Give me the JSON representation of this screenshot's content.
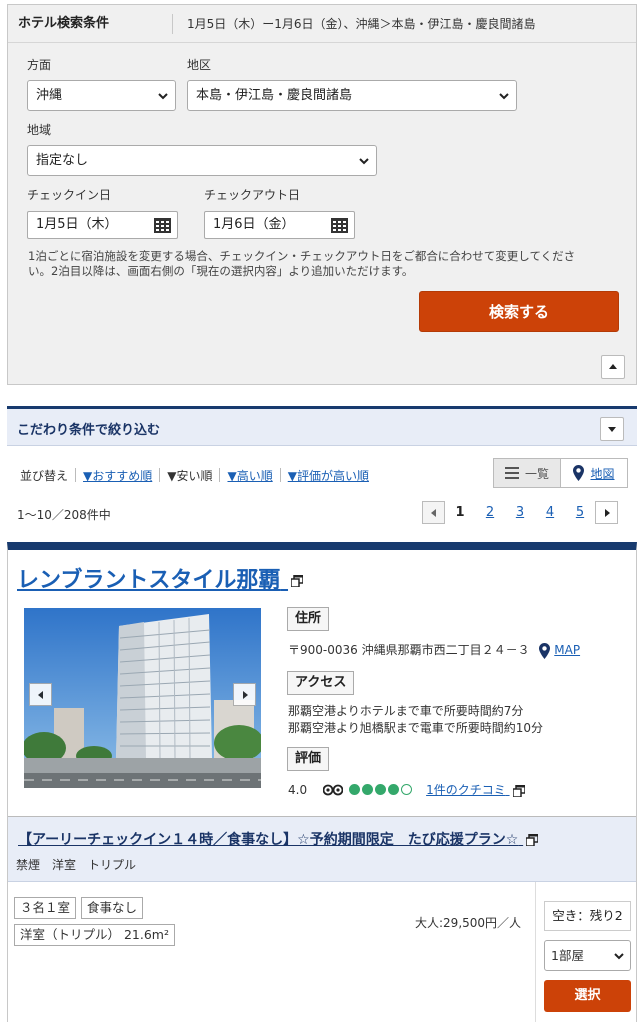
{
  "search_panel": {
    "title": "ホテル検索条件",
    "summary": "1月5日（木）ー1月6日（金）、沖縄＞本島・伊江島・慶良間諸島",
    "direction_label": "方面",
    "direction_value": "沖縄",
    "district_label": "地区",
    "district_value": "本島・伊江島・慶良間諸島",
    "area_label": "地域",
    "area_value": "指定なし",
    "checkin_label": "チェックイン日",
    "checkin_value": "1月5日（木）",
    "checkout_label": "チェックアウト日",
    "checkout_value": "1月6日（金）",
    "note_line1": "1泊ごとに宿泊施設を変更する場合、チェックイン・チェックアウト日をご都合に合わせて変更してくださ",
    "note_line2": "い。2泊目以降は、画面右側の「現在の選択内容」より追加いただけます。",
    "search_button": "検索する"
  },
  "filter_panel": {
    "title": "こだわり条件で絞り込む"
  },
  "sort": {
    "label": "並び替え",
    "options": [
      "▼おすすめ順",
      "▼安い順",
      "▼高い順",
      "▼評価が高い順"
    ],
    "view_list": "一覧",
    "view_map": "地図"
  },
  "results": {
    "count": "1〜10／208件中",
    "pages": [
      "1",
      "2",
      "3",
      "4",
      "5"
    ]
  },
  "hotel": {
    "name": "レンブラントスタイル那覇",
    "address_tag": "住所",
    "address": "〒900-0036 沖縄県那覇市西二丁目２４－３",
    "map_link": "MAP",
    "access_tag": "アクセス",
    "access_line1": "那覇空港よりホテルまで車で所要時間約7分",
    "access_line2": "那覇空港より旭橋駅まで電車で所要時間約10分",
    "rating_tag": "評価",
    "rating_value": "4.0",
    "rating_dots": 4,
    "reviews_link": "1件のクチコミ"
  },
  "plan": {
    "title": "【アーリーチェックイン１４時／食事なし】☆予約期間限定　たび応援プラン☆",
    "meta": [
      "禁煙",
      "洋室",
      "トリプル"
    ],
    "room_tag1": "３名１室",
    "room_tag2": "食事なし",
    "room_tag3": "洋室（トリプル） 21.6m²",
    "price": "大人:29,500円／人",
    "availability": "空き：残り2",
    "rooms_value": "1部屋",
    "select_button": "選択"
  }
}
